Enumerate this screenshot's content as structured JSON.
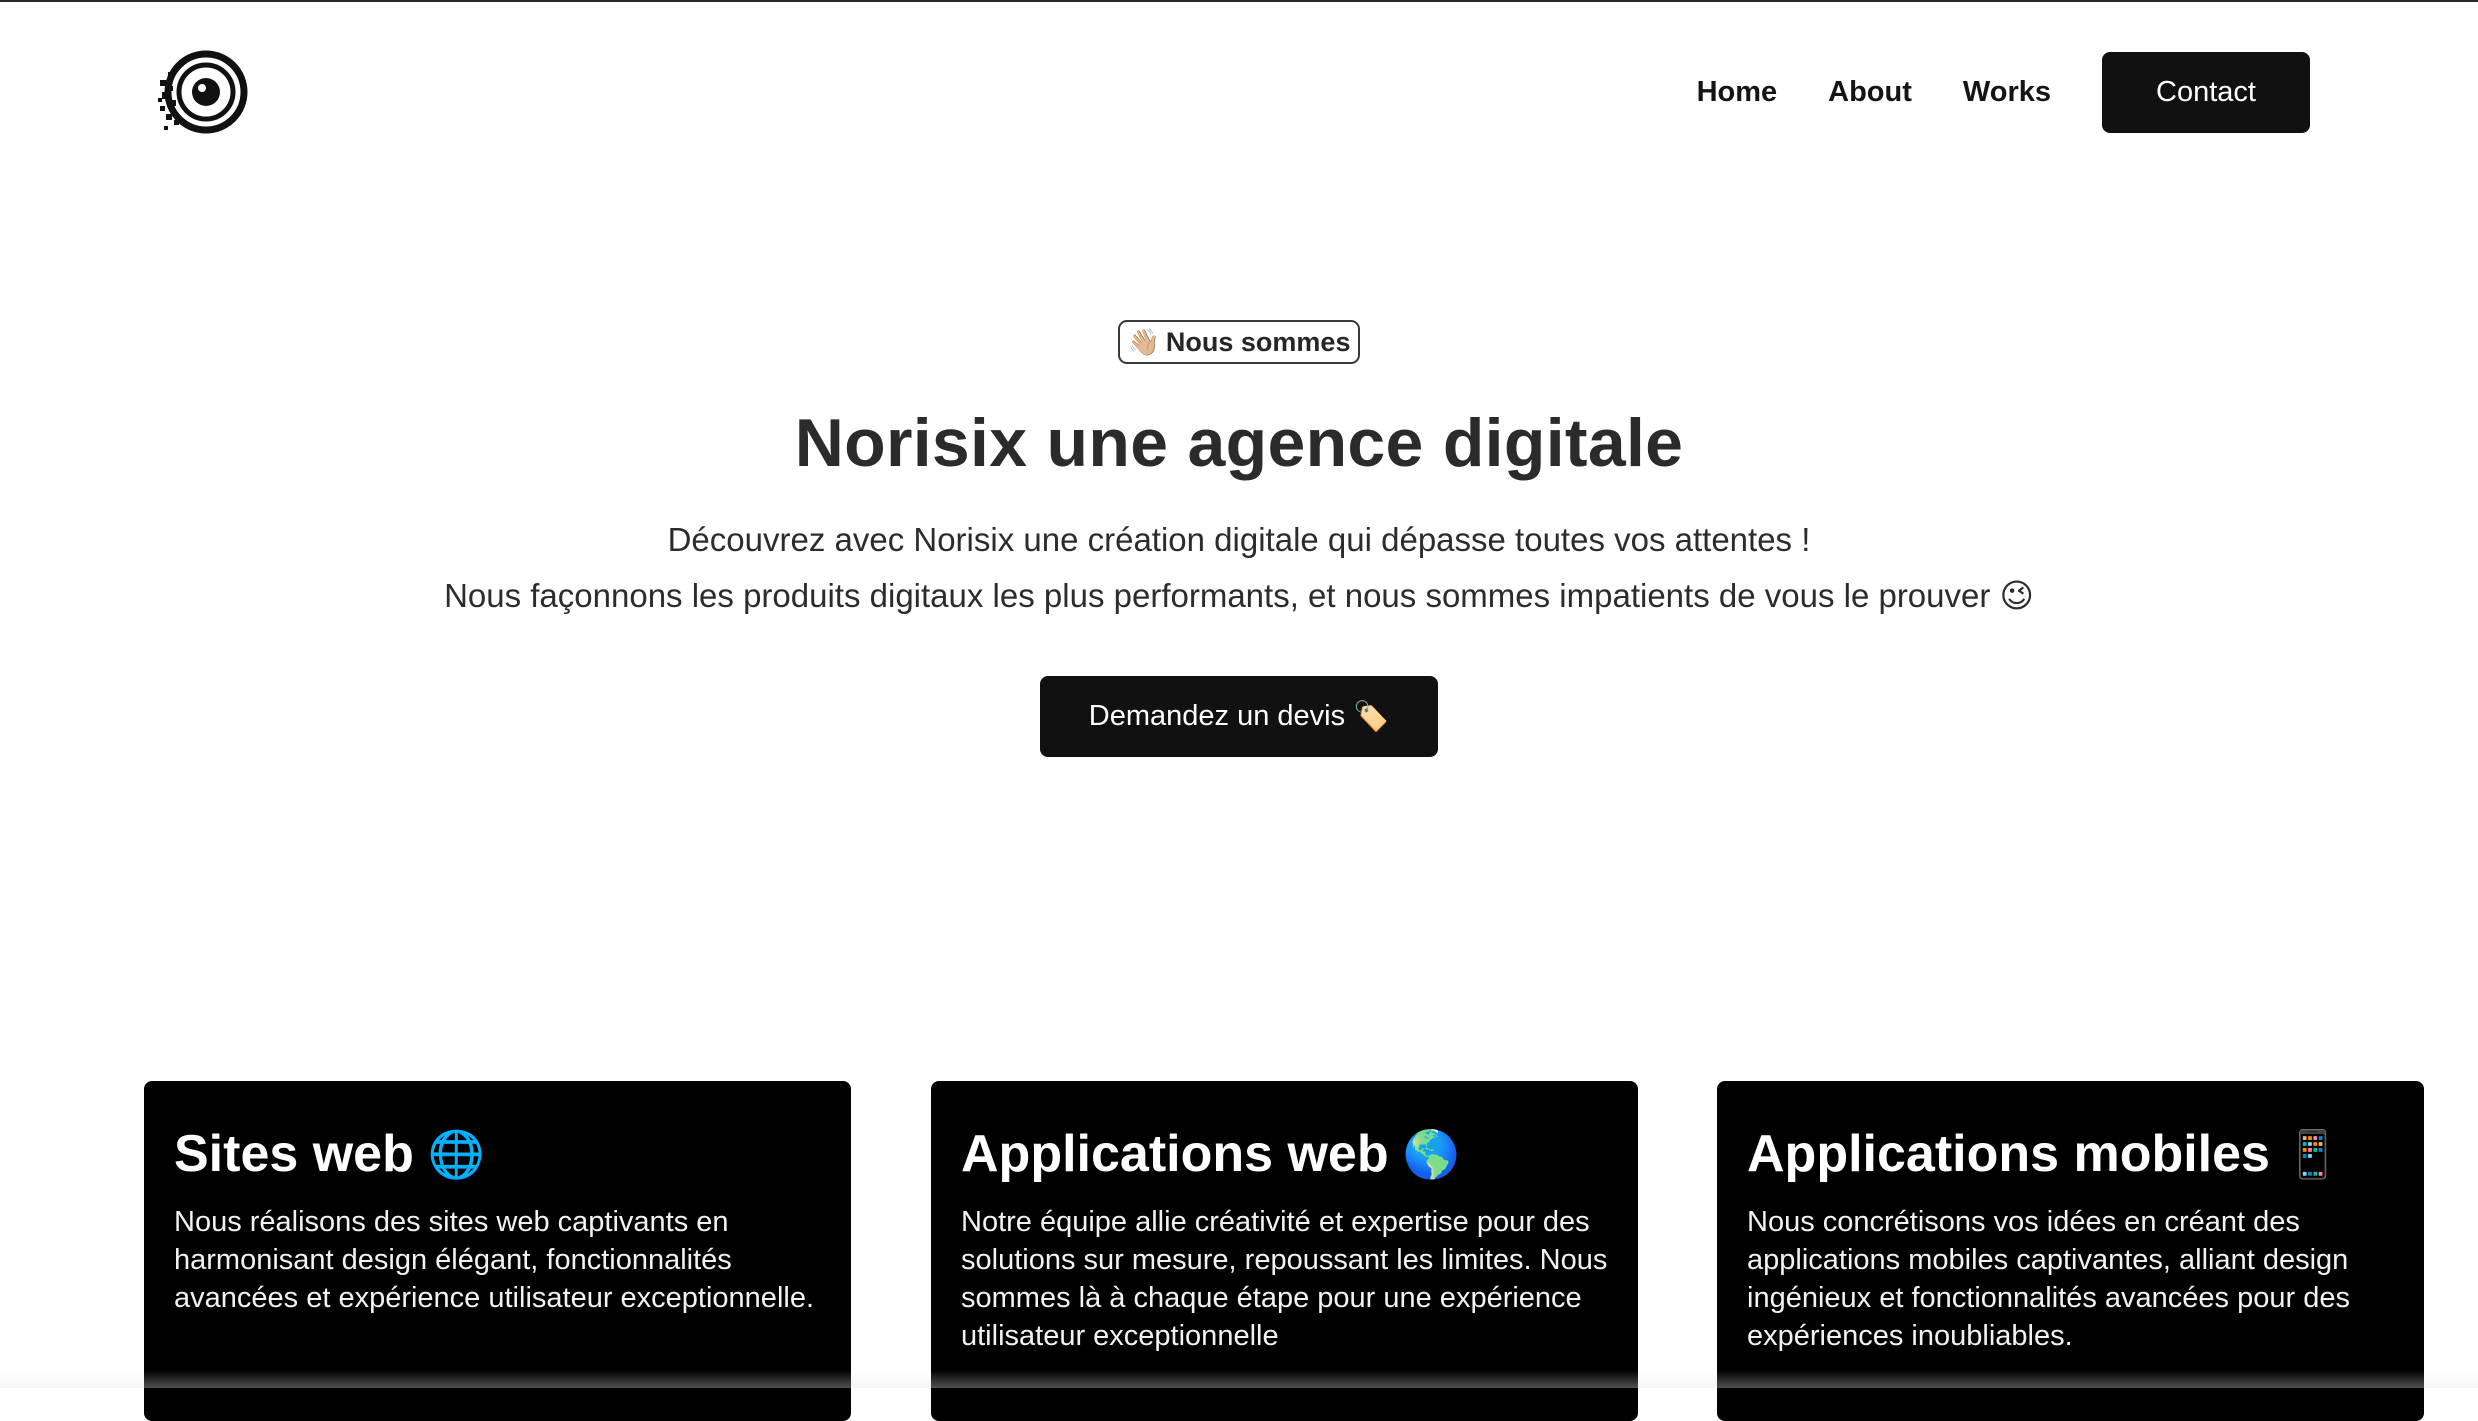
{
  "nav": {
    "items": [
      {
        "label": "Home"
      },
      {
        "label": "About"
      },
      {
        "label": "Works"
      }
    ],
    "contact_label": "Contact"
  },
  "hero": {
    "badge_emoji": "👋🏼",
    "badge_label": "Nous sommes",
    "title": "Norisix une agence digitale",
    "line1": "Découvrez avec Norisix une création digitale qui dépasse toutes vos attentes !",
    "line2": "Nous façonnons les produits digitaux les plus performants, et nous sommes impatients de vous le prouver",
    "line2_emoji": "😉",
    "cta_label": "Demandez un devis",
    "cta_emoji": "🏷️"
  },
  "cards": [
    {
      "title": "Sites web",
      "emoji": "🌐",
      "text": "Nous réalisons des sites web captivants en harmonisant design élégant, fonctionnalités avancées et expérience utilisateur exceptionnelle."
    },
    {
      "title": "Applications web",
      "emoji": "🌎",
      "text": "Notre équipe allie créativité et expertise pour des solutions sur mesure, repoussant les limites. Nous sommes là à chaque étape pour une expérience utilisateur exceptionnelle"
    },
    {
      "title": "Applications mobiles",
      "emoji": "📱",
      "text": "Nous concrétisons vos idées en créant des applications mobiles captivantes, alliant design ingénieux et fonctionnalités avancées pour des expériences inoubliables."
    }
  ]
}
